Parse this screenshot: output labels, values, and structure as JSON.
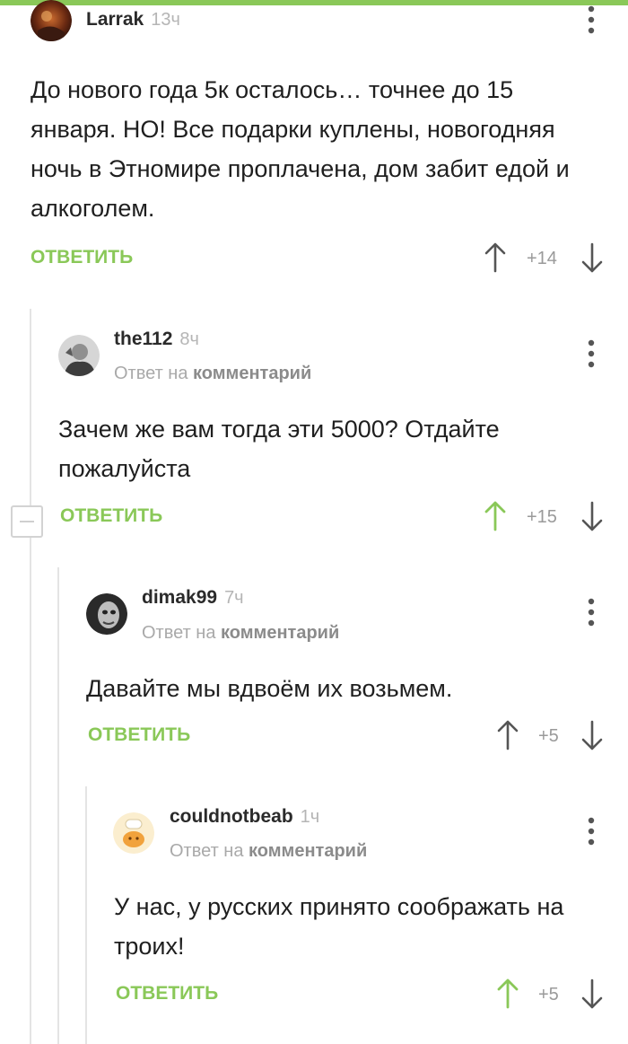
{
  "comments": [
    {
      "username": "Larrak",
      "time": "13ч",
      "reply_prefix": "",
      "reply_link": "",
      "text": "До нового года 5к осталось… точнее до 15 января. НО! Все подарки куплены, новогодняя ночь в Этномире проплачена, дом забит едой и алкоголем.",
      "reply_label": "ОТВЕТИТЬ",
      "score": "+14",
      "upvoted": false
    },
    {
      "username": "the112",
      "time": "8ч",
      "reply_prefix": "Ответ на",
      "reply_link": "комментарий",
      "text": "Зачем же вам тогда эти 5000? Отдайте пожалуйста",
      "reply_label": "ОТВЕТИТЬ",
      "score": "+15",
      "upvoted": true
    },
    {
      "username": "dimak99",
      "time": "7ч",
      "reply_prefix": "Ответ на",
      "reply_link": "комментарий",
      "text": "Давайте мы вдвоём их возьмем.",
      "reply_label": "ОТВЕТИТЬ",
      "score": "+5",
      "upvoted": false
    },
    {
      "username": "couldnotbeab",
      "time": "1ч",
      "reply_prefix": "Ответ на",
      "reply_link": "комментарий",
      "text": "У нас, у русских принято соображать на троих!",
      "reply_label": "ОТВЕТИТЬ",
      "score": "+5",
      "upvoted": true
    }
  ],
  "colors": {
    "accent": "#8ac858",
    "text": "#1f1f1f",
    "muted": "#a9a9a9"
  },
  "icons": [
    "avatar",
    "upvote-arrow-icon",
    "downvote-arrow-icon",
    "more-menu-icon",
    "collapse-thread-icon"
  ]
}
